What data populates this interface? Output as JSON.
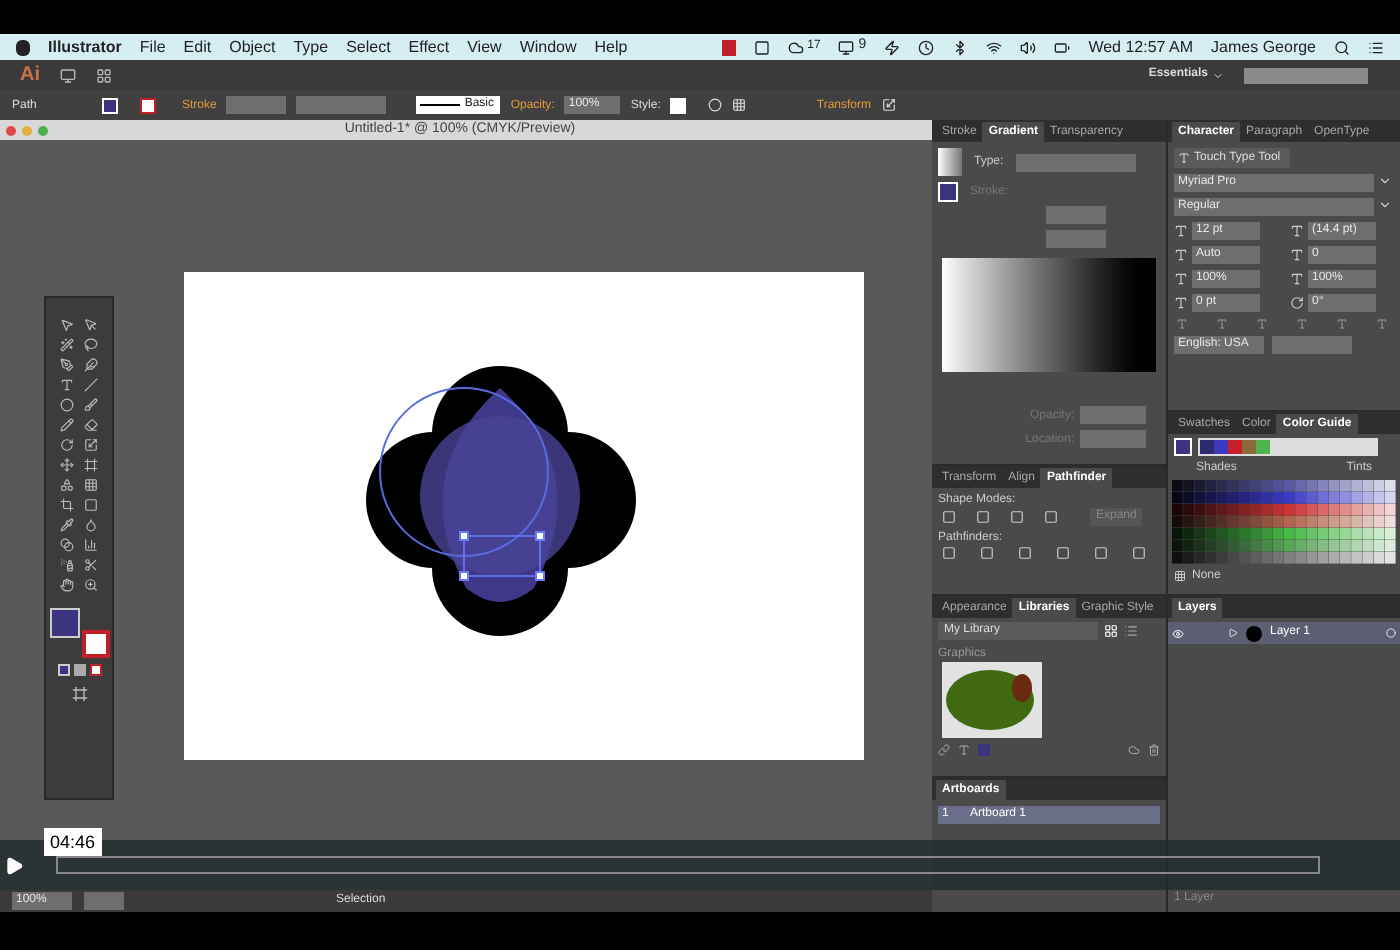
{
  "menu_bar": {
    "app": "Illustrator",
    "items": [
      "File",
      "Edit",
      "Object",
      "Type",
      "Select",
      "Effect",
      "View",
      "Window",
      "Help"
    ],
    "badges": [
      "17",
      "9"
    ],
    "clock": "Wed 12:57 AM",
    "user": "James George"
  },
  "app_bar": {
    "logo": "Ai",
    "workspace": "Essentials"
  },
  "control_bar": {
    "object": "Path",
    "stroke_label": "Stroke",
    "brush": "Basic",
    "opacity_label": "Opacity:",
    "opacity": "100%",
    "style_label": "Style:",
    "transform": "Transform"
  },
  "document": {
    "title": "Untitled-1* @ 100% (CMYK/Preview)"
  },
  "gradient_panel": {
    "tabs": [
      {
        "label": "Stroke",
        "selected": false
      },
      {
        "label": "Gradient",
        "selected": true
      },
      {
        "label": "Transparency",
        "selected": false
      }
    ],
    "type_label": "Type:",
    "stroke_label": "Stroke:",
    "opacity_label": "Opacity:",
    "location_label": "Location:"
  },
  "pathfinder_panel": {
    "tabs": [
      {
        "label": "Transform",
        "selected": false
      },
      {
        "label": "Align",
        "selected": false
      },
      {
        "label": "Pathfinder",
        "selected": true
      }
    ],
    "shape_modes": "Shape Modes:",
    "expand": "Expand",
    "pathfinders": "Pathfinders:"
  },
  "libraries_panel": {
    "tabs": [
      {
        "label": "Appearance",
        "selected": false
      },
      {
        "label": "Libraries",
        "selected": true
      },
      {
        "label": "Graphic Style",
        "selected": false
      }
    ],
    "library": "My Library",
    "section": "Graphics"
  },
  "artboards_panel": {
    "title": "Artboards",
    "rows": [
      {
        "number": "1",
        "name": "Artboard 1"
      }
    ]
  },
  "character_panel": {
    "tabs": [
      {
        "label": "Character",
        "selected": true
      },
      {
        "label": "Paragraph",
        "selected": false
      },
      {
        "label": "OpenType",
        "selected": false
      }
    ],
    "touch_type": "Touch Type Tool",
    "font": "Myriad Pro",
    "style": "Regular",
    "fields": [
      "12 pt",
      "(14.4 pt)",
      "Auto",
      "0",
      "100%",
      "100%",
      "0 pt",
      "0°"
    ],
    "language": "English: USA"
  },
  "color_guide_panel": {
    "tabs": [
      {
        "label": "Swatches",
        "selected": false
      },
      {
        "label": "Color",
        "selected": false
      },
      {
        "label": "Color Guide",
        "selected": true
      }
    ],
    "swatches": [
      {
        "color": "#2e2a6e"
      },
      {
        "color": "#3b3bbf"
      },
      {
        "color": "#c8202a"
      },
      {
        "color": "#8a6a3a"
      },
      {
        "color": "#4fb44f"
      }
    ],
    "shades": "Shades",
    "tints": "Tints",
    "none": "None"
  },
  "layers_panel": {
    "title": "Layers",
    "layers": [
      {
        "name": "Layer 1"
      }
    ],
    "count": "1 Layer"
  },
  "status_bar": {
    "zoom": "100%",
    "tool": "Selection"
  },
  "video_player": {
    "time": "04:46"
  }
}
